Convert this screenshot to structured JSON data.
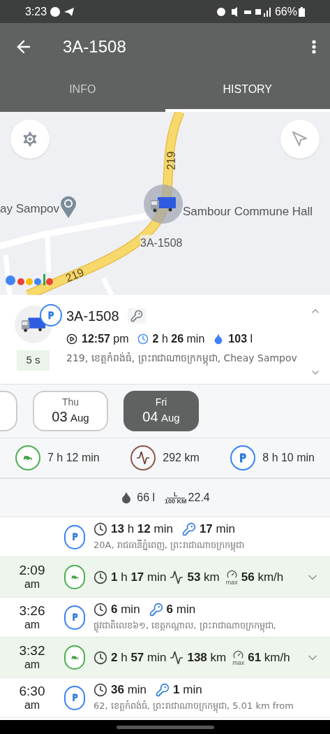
{
  "status_bar": {
    "time": "3:23",
    "battery": "66%"
  },
  "app_bar": {
    "title": "3A-1508"
  },
  "tabs": [
    {
      "label": "INFO",
      "selected": false
    },
    {
      "label": "HISTORY",
      "selected": true
    }
  ],
  "map": {
    "labels": [
      {
        "kind": "road",
        "text": "219"
      },
      {
        "kind": "road",
        "text": "219"
      },
      {
        "kind": "place",
        "text": "ay Sampov"
      },
      {
        "kind": "place",
        "text": "Sambour Commune Hall"
      },
      {
        "kind": "vehicle",
        "text": "3A-1508"
      }
    ]
  },
  "vehicle_card": {
    "name": "3A-1508",
    "badge": "5 s",
    "start": "**12:57** pm",
    "duration": "**2** h **26** min",
    "fuel": "**103** l",
    "address": "219, ខេត្តកំពង់ធំ, ព្រះរាជាណាចក្រកម្ពុជា, Cheay Sampov"
  },
  "dates": [
    {
      "weekday": "Thu",
      "day": "03",
      "month": "Aug",
      "selected": false
    },
    {
      "weekday": "Fri",
      "day": "04",
      "month": "Aug",
      "selected": true
    }
  ],
  "summary": [
    {
      "kind": "driving",
      "value": "7 h 12 min"
    },
    {
      "kind": "distance",
      "value": "292 km"
    },
    {
      "kind": "parking",
      "value": "8 h 10 min"
    }
  ],
  "fuel": {
    "used": "66 l",
    "unit_top": "L",
    "unit_bottom": "100 KM",
    "rate": "22.4"
  },
  "timeline": [
    {
      "kind": "parking",
      "duration": "**13** h **12** min",
      "ignition": "**17** min",
      "address": "20A, រាជធានីភ្នំពេញ, ព្រះរាជាណាចក្រកម្ពុជា"
    },
    {
      "kind": "driving",
      "time": "2:09",
      "ampm": "am",
      "duration": "**1** h **17** min",
      "distance": "**53** km",
      "speed_label": "max",
      "speed": "**56** km/h"
    },
    {
      "kind": "parking",
      "time": "3:26",
      "ampm": "am",
      "duration": "**6** min",
      "ignition": "**6** min",
      "address": "ផ្លូវជាតិលេខ៦១, ខេត្តកណ្ដាល, ព្រះរាជាណាចក្រកម្ពុជា,"
    },
    {
      "kind": "driving",
      "time": "3:32",
      "ampm": "am",
      "duration": "**2** h **57** min",
      "distance": "**138** km",
      "speed_label": "max",
      "speed": "**61** km/h"
    },
    {
      "kind": "parking",
      "time": "6:30",
      "ampm": "am",
      "duration": "**36** min",
      "ignition": "**1** min",
      "address": "62, ខេត្តកំពង់ធំ, ព្រះរាជាណាចក្រកម្ពុជា, 5.01 km from"
    }
  ]
}
